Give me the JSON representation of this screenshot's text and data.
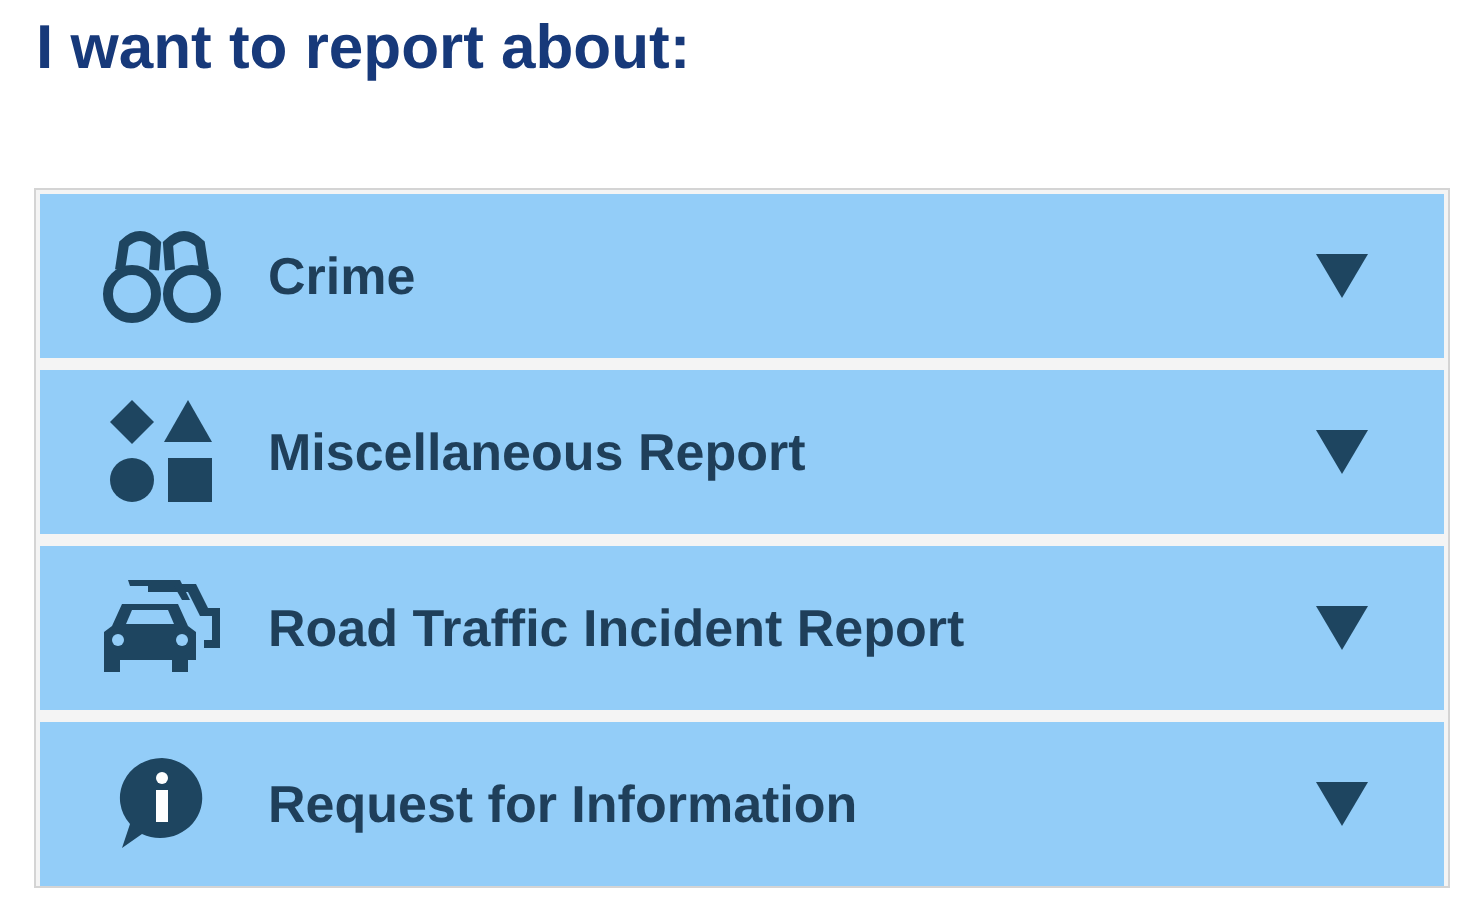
{
  "heading": "I want to report about:",
  "items": [
    {
      "label": "Crime",
      "expanded": false
    },
    {
      "label": "Miscellaneous Report",
      "expanded": false
    },
    {
      "label": "Road Traffic Incident Report",
      "expanded": false
    },
    {
      "label": "Request for Information",
      "expanded": false
    }
  ]
}
